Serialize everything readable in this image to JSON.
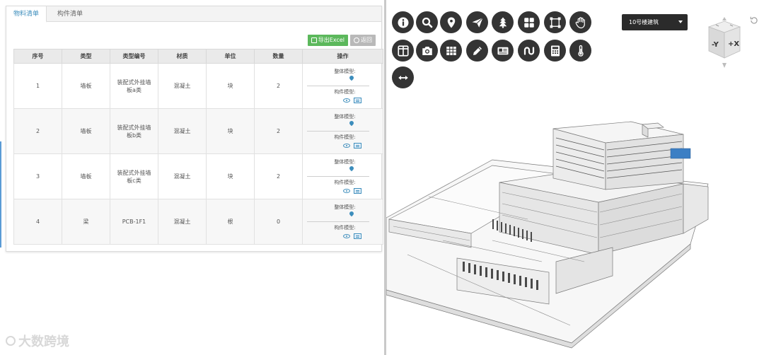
{
  "tabs": [
    {
      "label": "物料清单",
      "active": true
    },
    {
      "label": "构件清单",
      "active": false
    }
  ],
  "toolbar": {
    "export_label": "导出Excel",
    "back_label": "返回"
  },
  "table": {
    "headers": [
      "序号",
      "类型",
      "类型编号",
      "材质",
      "单位",
      "数量",
      "操作"
    ],
    "ops_labels": {
      "whole": "整体模型:",
      "component": "构件模型:"
    },
    "rows": [
      {
        "no": "1",
        "type": "墙板",
        "code": "装配式外挂墙板a类",
        "material": "混凝土",
        "unit": "块",
        "qty": "2"
      },
      {
        "no": "2",
        "type": "墙板",
        "code": "装配式外挂墙板b类",
        "material": "混凝土",
        "unit": "块",
        "qty": "2"
      },
      {
        "no": "3",
        "type": "墙板",
        "code": "装配式外挂墙板c类",
        "material": "混凝土",
        "unit": "块",
        "qty": "2"
      },
      {
        "no": "4",
        "type": "梁",
        "code": "PCB-1F1",
        "material": "混凝土",
        "unit": "根",
        "qty": "0"
      }
    ]
  },
  "watermark": "大数跨境",
  "viewer": {
    "building_select": "10号楼建筑",
    "cube_labels": {
      "left": "-Y",
      "right": "+X"
    },
    "toolbar_icons": [
      "info-icon",
      "search-icon",
      "location-pin-icon",
      "send-icon",
      "tree-icon",
      "grid-view-icon",
      "bounding-box-icon",
      "hand-pan-icon",
      "split-view-icon",
      "camera-icon",
      "table-icon",
      "pencil-icon",
      "layers-card-icon",
      "path-icon",
      "calculator-icon",
      "thermometer-icon",
      "measure-arrows-icon"
    ]
  },
  "colors": {
    "accent": "#3c8dbc",
    "export_button": "#5cb85c",
    "back_button": "#b9b9b9",
    "toolbar_button": "#343434"
  }
}
